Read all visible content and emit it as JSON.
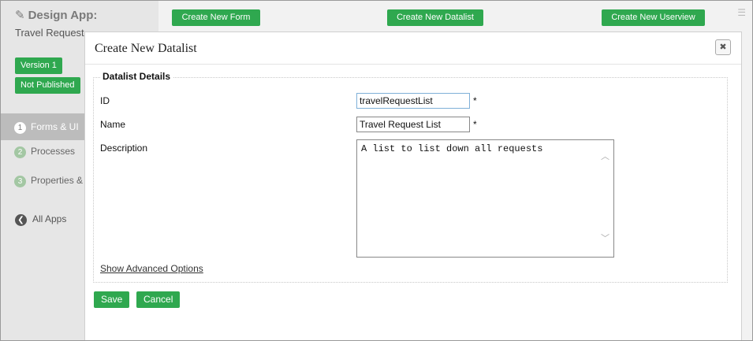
{
  "sidebar": {
    "app_title": "Design App:",
    "app_name": "Travel Request",
    "version_badge": "Version 1",
    "status_badge": "Not Published",
    "nav": [
      {
        "num": "1",
        "label": "Forms & UI"
      },
      {
        "num": "2",
        "label": "Processes"
      },
      {
        "num": "3",
        "label": "Properties & Export"
      }
    ],
    "all_apps": "All Apps"
  },
  "toolbar": {
    "create_form": "Create New Form",
    "create_datalist": "Create New Datalist",
    "create_userview": "Create New Userview"
  },
  "dialog": {
    "title": "Create New Datalist",
    "close_symbol": "✖",
    "section_legend": "Datalist Details",
    "fields": {
      "id": {
        "label": "ID",
        "value": "travelRequestList",
        "required": "*"
      },
      "name": {
        "label": "Name",
        "value": "Travel Request List",
        "required": "*"
      },
      "description": {
        "label": "Description",
        "value": "A list to list down all requests"
      }
    },
    "advanced_link": "Show Advanced Options",
    "save_label": "Save",
    "cancel_label": "Cancel"
  },
  "colors": {
    "accent_green": "#2fa84f",
    "input_border_blue": "#7fb0d8",
    "sidebar_bg": "#e6e6e6"
  },
  "icons": {
    "edit": "edit-icon",
    "back": "back-arrow-icon",
    "grid": "grid-menu-icon",
    "close": "close-icon"
  }
}
